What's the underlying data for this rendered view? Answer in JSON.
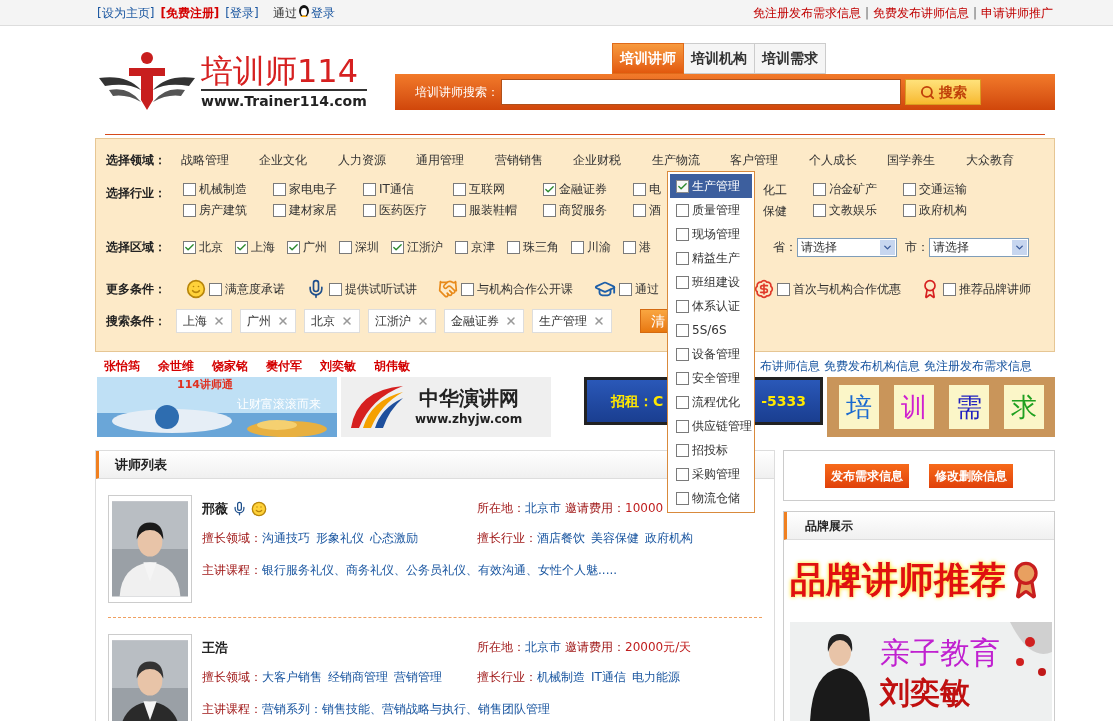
{
  "top_bar": {
    "set_home": "[设为主页]",
    "register": "[免费注册]",
    "login": "[登录]",
    "qq_before": "通过",
    "qq_after": "登录",
    "separator": "|",
    "right": [
      "免注册发布需求信息",
      "免费发布讲师信息",
      "申请讲师推广"
    ]
  },
  "logo": {
    "title": "培训师114",
    "url": "www.Trainer114.com"
  },
  "search": {
    "tabs": [
      {
        "label": "培训讲师",
        "selected": true
      },
      {
        "label": "培训机构",
        "selected": false
      },
      {
        "label": "培训需求",
        "selected": false
      }
    ],
    "label": "培训讲师搜索：",
    "button": "搜索"
  },
  "filters": {
    "domain": {
      "label": "选择领域：",
      "items": [
        "战略管理",
        "企业文化",
        "人力资源",
        "通用管理",
        "营销销售",
        "企业财税",
        "生产物流",
        "客户管理",
        "个人成长",
        "国学养生",
        "大众教育"
      ]
    },
    "industry": {
      "label": "选择行业：",
      "rows": [
        [
          {
            "kind": "box",
            "text": "机械制造",
            "checked": false
          },
          {
            "kind": "box",
            "text": "家电电子",
            "checked": false
          },
          {
            "kind": "box",
            "text": "IT通信",
            "checked": false
          },
          {
            "kind": "box",
            "text": "互联网",
            "checked": false
          },
          {
            "kind": "box",
            "text": "金融证券",
            "checked": true
          },
          {
            "kind": "box",
            "text": "电",
            "checked": false
          },
          {
            "kind": "tail",
            "text": "化工"
          },
          {
            "kind": "box",
            "text": "冶金矿产",
            "checked": false
          },
          {
            "kind": "box",
            "text": "交通运输",
            "checked": false
          }
        ],
        [
          {
            "kind": "box",
            "text": "房产建筑",
            "checked": false
          },
          {
            "kind": "box",
            "text": "建材家居",
            "checked": false
          },
          {
            "kind": "box",
            "text": "医药医疗",
            "checked": false
          },
          {
            "kind": "box",
            "text": "服装鞋帽",
            "checked": false
          },
          {
            "kind": "box",
            "text": "商贸服务",
            "checked": false
          },
          {
            "kind": "box",
            "text": "酒",
            "checked": false
          },
          {
            "kind": "tail",
            "text": "保健"
          },
          {
            "kind": "box",
            "text": "文教娱乐",
            "checked": false
          },
          {
            "kind": "box",
            "text": "政府机构",
            "checked": false
          }
        ]
      ]
    },
    "region": {
      "label": "选择区域：",
      "items": [
        {
          "text": "北京",
          "checked": true
        },
        {
          "text": "上海",
          "checked": true
        },
        {
          "text": "广州",
          "checked": true
        },
        {
          "text": "深圳",
          "checked": false
        },
        {
          "text": "江浙沪",
          "checked": true
        },
        {
          "text": "京津",
          "checked": false
        },
        {
          "text": "珠三角",
          "checked": false
        },
        {
          "text": "川渝",
          "checked": false
        },
        {
          "text": "港",
          "checked": false
        }
      ],
      "province": {
        "label": "省：",
        "value": "请选择"
      },
      "city": {
        "label": "市：",
        "value": "请选择"
      }
    },
    "more": {
      "label": "更多条件：",
      "items": [
        {
          "kind": "smile",
          "text": "满意度承诺",
          "checked": false
        },
        {
          "kind": "mic",
          "text": "提供试听试讲",
          "checked": false
        },
        {
          "kind": "handshake",
          "text": "与机构合作公开课",
          "checked": false
        },
        {
          "kind": "cap",
          "text": "通过",
          "checked": false
        },
        {
          "kind": "dollar",
          "text": "首次与机构合作优惠",
          "checked": false
        },
        {
          "kind": "award",
          "text": "推荐品牌讲师",
          "checked": false
        }
      ]
    },
    "criteria": {
      "label": "搜索条件：",
      "tags": [
        "上海",
        "广州",
        "北京",
        "江浙沪",
        "金融证券",
        "生产管理"
      ],
      "clear": "清"
    }
  },
  "dropdown": {
    "items": [
      {
        "label": "生产管理",
        "checked": true,
        "selected": true
      },
      {
        "label": "质量管理",
        "checked": false,
        "selected": false
      },
      {
        "label": "现场管理",
        "checked": false,
        "selected": false
      },
      {
        "label": "精益生产",
        "checked": false,
        "selected": false
      },
      {
        "label": "班组建设",
        "checked": false,
        "selected": false
      },
      {
        "label": "体系认证",
        "checked": false,
        "selected": false
      },
      {
        "label": "5S/6S",
        "checked": false,
        "selected": false
      },
      {
        "label": "设备管理",
        "checked": false,
        "selected": false
      },
      {
        "label": "安全管理",
        "checked": false,
        "selected": false
      },
      {
        "label": "流程优化",
        "checked": false,
        "selected": false
      },
      {
        "label": "供应链管理",
        "checked": false,
        "selected": false
      },
      {
        "label": "招投标",
        "checked": false,
        "selected": false
      },
      {
        "label": "采购管理",
        "checked": false,
        "selected": false
      },
      {
        "label": "物流仓储",
        "checked": false,
        "selected": false
      }
    ]
  },
  "featured": {
    "names": [
      "张怡筠",
      "余世维",
      "饶家铭",
      "樊付军",
      "刘奕敏",
      "胡伟敏"
    ],
    "links": [
      "布讲师信息",
      "免费发布机构信息",
      "免注册发布需求信息"
    ]
  },
  "banners": [
    {
      "kind": "wealth",
      "title": "114讲师通",
      "slogan": "让财富滚滚而来"
    },
    {
      "kind": "brand",
      "title": "中华演讲网",
      "url": "www.zhyjw.com"
    },
    {
      "kind": "rent",
      "before": "招租：C",
      "after": "-5333"
    },
    {
      "kind": "notes",
      "chars": [
        "培",
        "训",
        "需",
        "求"
      ]
    }
  ],
  "trainer_list": {
    "title": "讲师列表",
    "trainers": [
      {
        "name": "邢薇",
        "badges": [
          {
            "kind": "mic"
          },
          {
            "kind": "smile"
          }
        ],
        "location_label": "所在地：",
        "location": "北京市",
        "fee_label": "邀请费用：",
        "fee": "10000",
        "domain_label": "擅长领域：",
        "domains": [
          "沟通技巧",
          "形象礼仪",
          "心态激励"
        ],
        "industry_label": "擅长行业：",
        "industries": [
          "酒店餐饮",
          "美容保健",
          "政府机构"
        ],
        "course_label": "主讲课程：",
        "course": "银行服务礼仪、商务礼仪、公务员礼仪、有效沟通、女性个人魅....."
      },
      {
        "name": "王浩",
        "location_label": "所在地：",
        "location": "北京市",
        "fee_label": "邀请费用：",
        "fee": "20000元/天",
        "domain_label": "擅长领域：",
        "domains": [
          "大客户销售",
          "经销商管理",
          "营销管理"
        ],
        "industry_label": "擅长行业：",
        "industries": [
          "机械制造",
          "IT通信",
          "电力能源"
        ],
        "course_label": "主讲课程：",
        "course": "营销系列：销售技能、营销战略与执行、销售团队管理"
      }
    ]
  },
  "side": {
    "buttons": [
      "发布需求信息",
      "修改删除信息"
    ],
    "brand": {
      "title": "品牌展示",
      "headline": "品牌讲师推荐",
      "ad_title": "亲子教育",
      "ad_name": "刘奕敏"
    }
  }
}
